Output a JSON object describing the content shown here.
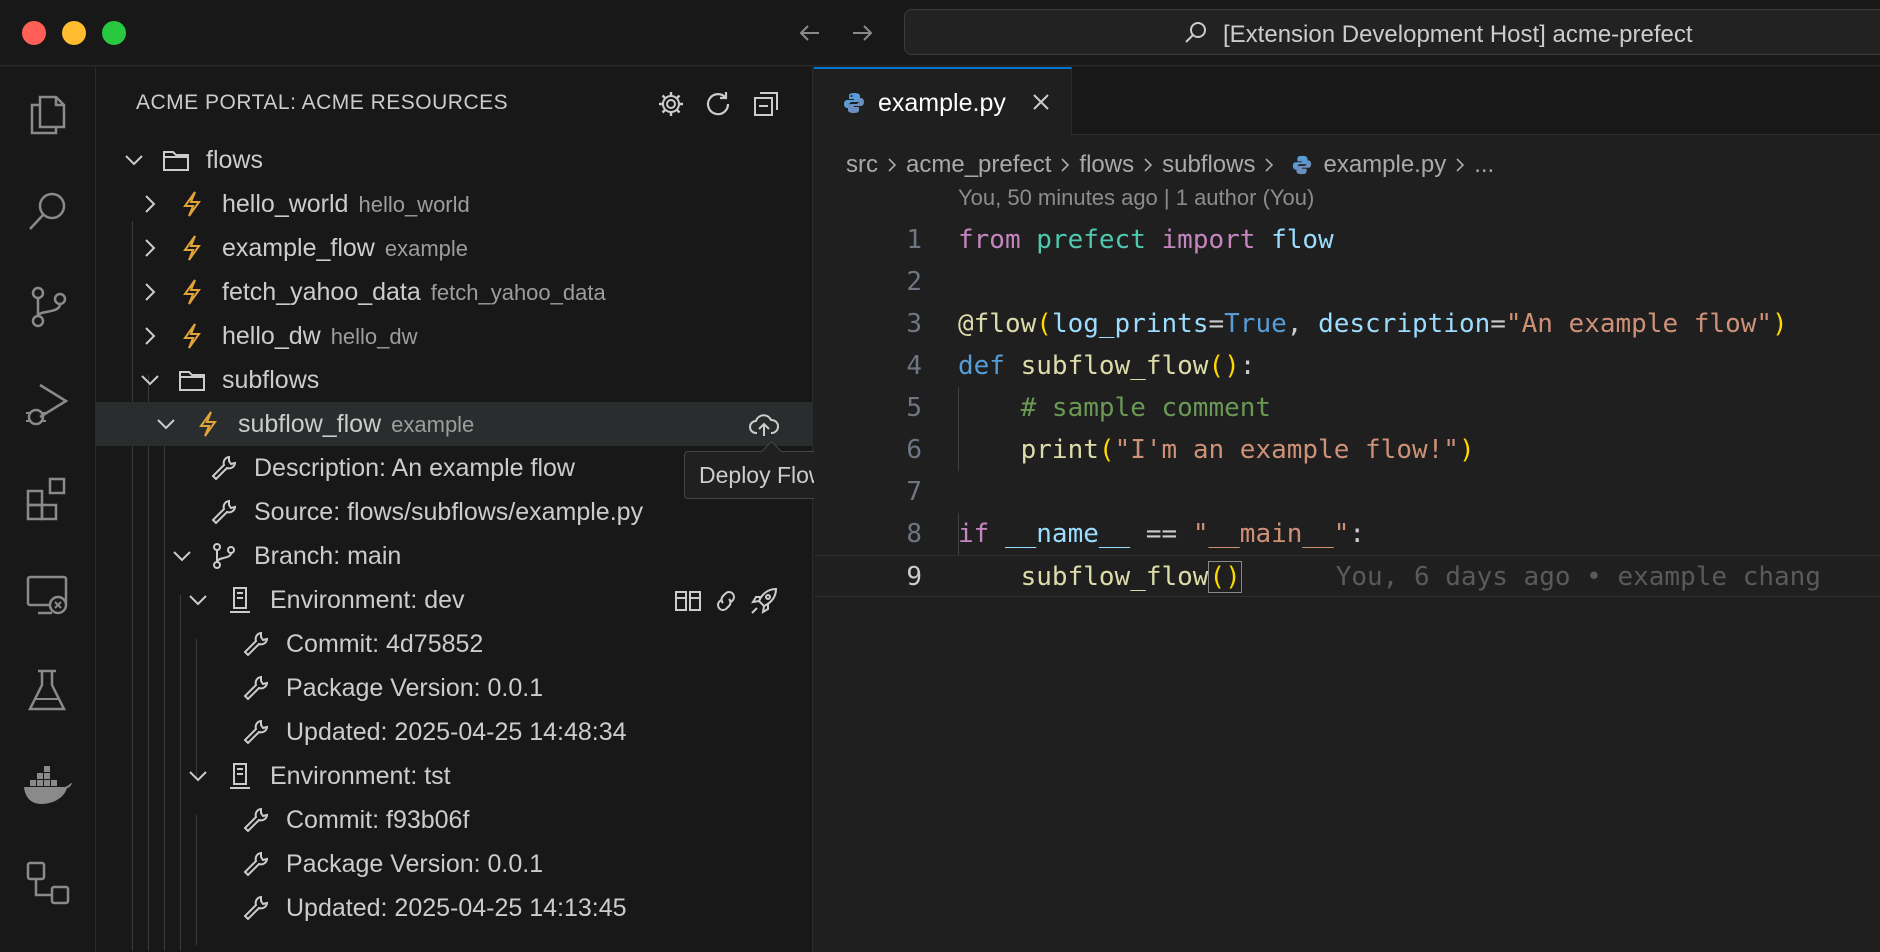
{
  "titlebar": {
    "title": "[Extension Development Host] acme-prefect",
    "back_icon": "arrow-left-icon",
    "forward_icon": "arrow-right-icon"
  },
  "activity_bar": {
    "items": [
      "explorer",
      "search",
      "source-control",
      "run-debug",
      "extensions",
      "remote-explorer",
      "testing",
      "docker",
      "acme-portal"
    ]
  },
  "sidebar": {
    "title": "ACME PORTAL: ACME RESOURCES",
    "actions": [
      "settings",
      "refresh",
      "collapse-all"
    ],
    "tree": {
      "flows": "flows",
      "hello_world": {
        "label": "hello_world",
        "desc": "hello_world"
      },
      "example_flow": {
        "label": "example_flow",
        "desc": "example"
      },
      "fetch_yahoo_data": {
        "label": "fetch_yahoo_data",
        "desc": "fetch_yahoo_data"
      },
      "hello_dw": {
        "label": "hello_dw",
        "desc": "hello_dw"
      },
      "subflows": "subflows",
      "subflow_flow": {
        "label": "subflow_flow",
        "desc": "example"
      },
      "description": "Description: An example flow",
      "source": "Source: flows/subflows/example.py",
      "branch": "Branch: main",
      "env_dev": {
        "label": "Environment: dev",
        "commit": "Commit: 4d75852",
        "package": "Package Version: 0.0.1",
        "updated": "Updated: 2025-04-25 14:48:34"
      },
      "env_tst": {
        "label": "Environment: tst",
        "commit": "Commit: f93b06f",
        "package": "Package Version: 0.0.1",
        "updated": "Updated: 2025-04-25 14:13:45"
      }
    },
    "tooltip": "Deploy Flow"
  },
  "editor": {
    "tab_label": "example.py",
    "breadcrumb": [
      "src",
      "acme_prefect",
      "flows",
      "subflows",
      "example.py",
      "..."
    ],
    "blame": "You, 50 minutes ago | 1 author (You)",
    "line_numbers": [
      "1",
      "2",
      "3",
      "4",
      "5",
      "6",
      "7",
      "8",
      "9"
    ],
    "inline_blame": "You, 6 days ago • example chang",
    "code": {
      "l1": {
        "from": "from",
        "mod": "prefect",
        "import": "import",
        "name": "flow"
      },
      "l3": {
        "at": "@flow",
        "p1": "(",
        "kw": "log_prints",
        "eq": "=",
        "val": "True",
        "comma": ", ",
        "kw2": "description",
        "eq2": "=",
        "str": "\"An example flow\"",
        "p2": ")"
      },
      "l4": {
        "def": "def",
        "fn": "subflow_flow",
        "p": "()",
        "colon": ":"
      },
      "l5": {
        "cmt": "# sample comment"
      },
      "l6": {
        "fn": "print",
        "p1": "(",
        "str": "\"I'm an example flow!\"",
        "p2": ")"
      },
      "l8": {
        "if": "if",
        "name": "__name__",
        "op": " == ",
        "str": "\"__main__\"",
        "colon": ":"
      },
      "l9": {
        "fn": "subflow_flow",
        "p": "()"
      }
    }
  },
  "colors": {
    "accent": "#0078d4",
    "flow_icon": "#e2a33a",
    "background": "#1f1f1f"
  }
}
